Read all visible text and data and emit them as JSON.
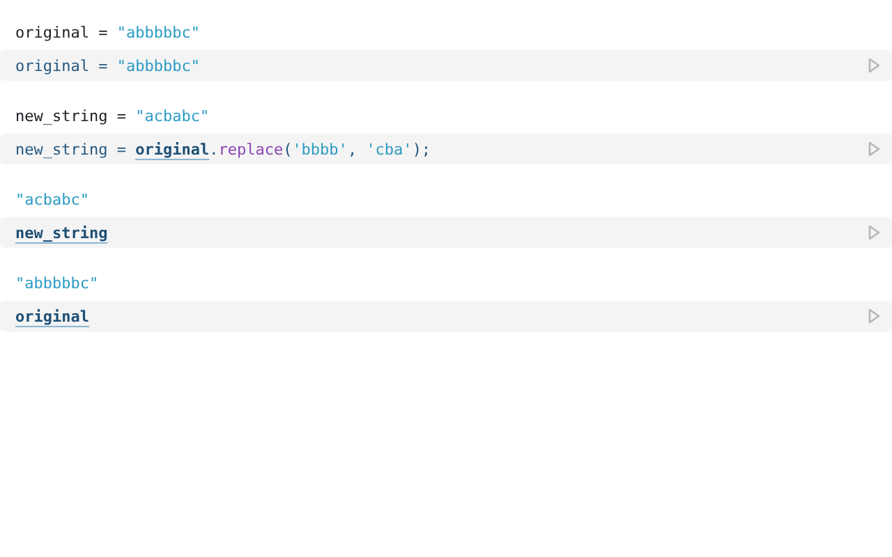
{
  "cells": [
    {
      "output": [
        {
          "kind": "text",
          "text": "original = "
        },
        {
          "kind": "string",
          "text": "\"abbbbbc\""
        }
      ],
      "code": [
        {
          "kind": "text",
          "text": "original = "
        },
        {
          "kind": "string",
          "text": "\"abbbbbc\""
        }
      ]
    },
    {
      "output": [
        {
          "kind": "text",
          "text": "new_string = "
        },
        {
          "kind": "string",
          "text": "\"acbabc\""
        }
      ],
      "code": [
        {
          "kind": "text",
          "text": "new_string = "
        },
        {
          "kind": "ref",
          "text": "original"
        },
        {
          "kind": "text",
          "text": "."
        },
        {
          "kind": "method",
          "text": "replace"
        },
        {
          "kind": "text",
          "text": "("
        },
        {
          "kind": "string",
          "text": "'bbbb'"
        },
        {
          "kind": "text",
          "text": ", "
        },
        {
          "kind": "string",
          "text": "'cba'"
        },
        {
          "kind": "text",
          "text": ");"
        }
      ]
    },
    {
      "output": [
        {
          "kind": "string",
          "text": "\"acbabc\""
        }
      ],
      "code": [
        {
          "kind": "ref",
          "text": "new_string"
        }
      ]
    },
    {
      "output": [
        {
          "kind": "string",
          "text": "\"abbbbbc\""
        }
      ],
      "code": [
        {
          "kind": "ref",
          "text": "original"
        }
      ]
    }
  ]
}
